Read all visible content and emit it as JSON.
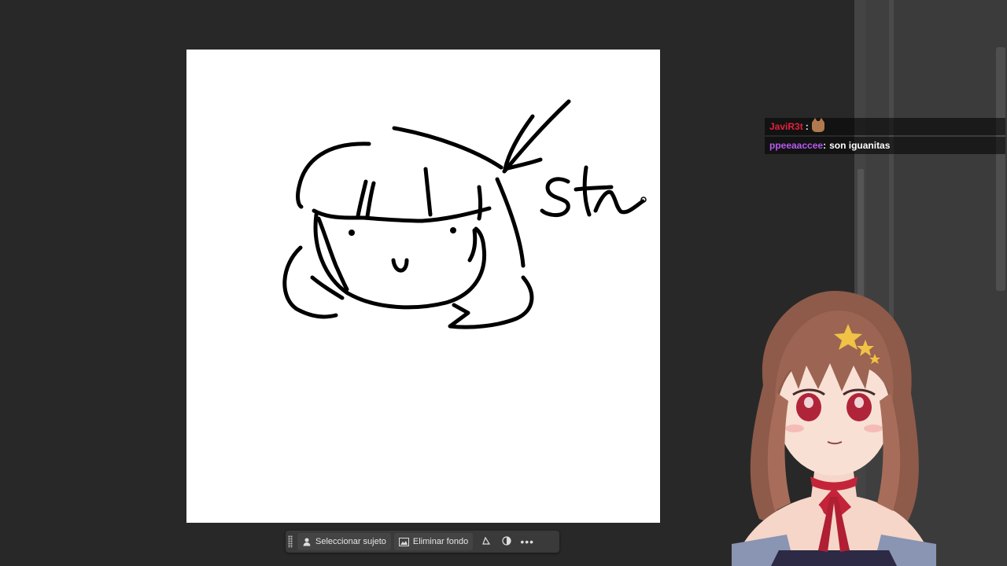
{
  "chat": {
    "messages": [
      {
        "user": "JaviR3t",
        "separator": " :",
        "text": "",
        "user_color": "#e0213a",
        "emote": "cat-emote-icon"
      },
      {
        "user": "ppeeaaccee",
        "separator": " :",
        "text": "son iguanitas",
        "user_color": "#b65bf0",
        "emote": ""
      }
    ]
  },
  "toolbar": {
    "select_subject_label": "Seleccionar sujeto",
    "remove_background_label": "Eliminar fondo",
    "icons": [
      "person-icon",
      "image-icon",
      "transform-icon",
      "adjust-icon",
      "more-icon"
    ]
  },
  "colors": {
    "workspace": "#282828",
    "canvas": "#ffffff",
    "ink": "#000000",
    "toolbar": "#3a3a3a"
  }
}
